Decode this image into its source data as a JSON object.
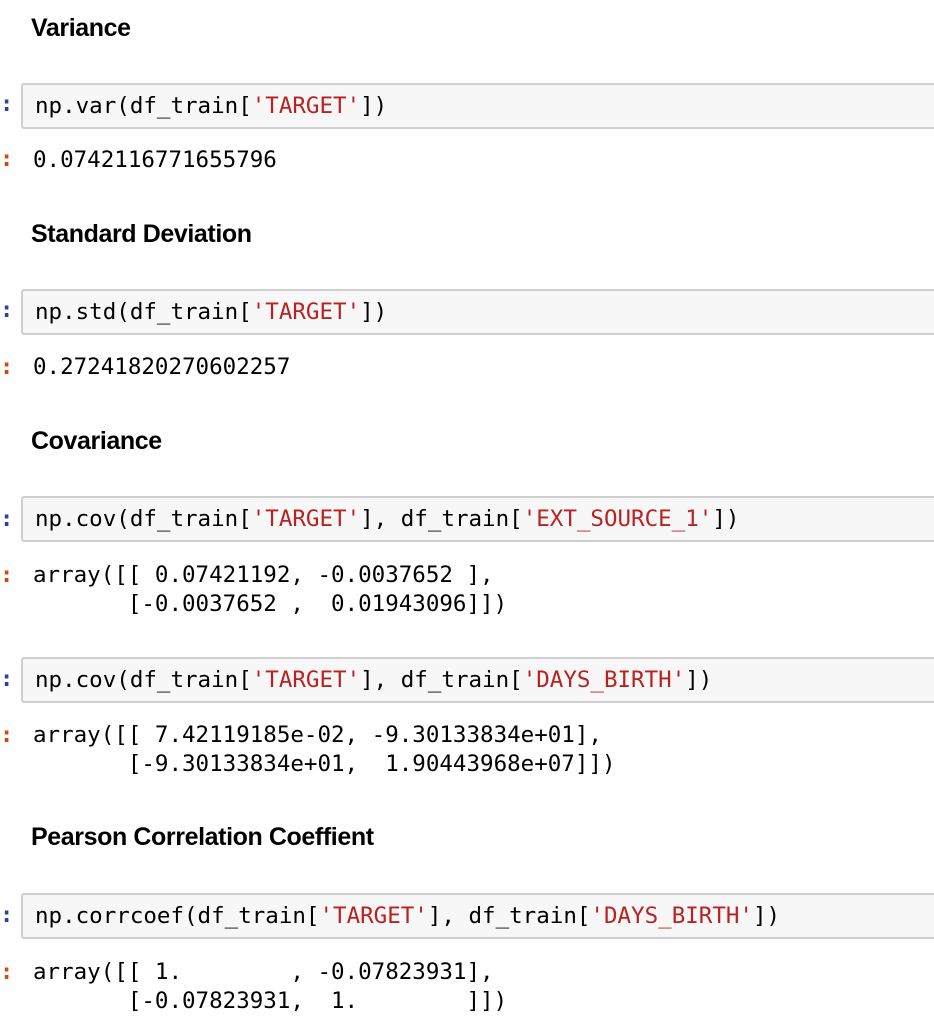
{
  "prompt_symbol": ":",
  "sections": {
    "variance": {
      "heading": "Variance",
      "cell": {
        "code_prefix": "np.var(df_train[",
        "code_str": "'TARGET'",
        "code_suffix": "])",
        "output": [
          "0.0742116771655796"
        ]
      }
    },
    "std": {
      "heading": "Standard Deviation",
      "cell": {
        "code_prefix": "np.std(df_train[",
        "code_str": "'TARGET'",
        "code_suffix": "])",
        "output": [
          "0.27241820270602257"
        ]
      }
    },
    "covariance": {
      "heading": "Covariance",
      "cells": [
        {
          "code_prefix": "np.cov(df_train[",
          "code_str1": "'TARGET'",
          "code_mid": "], df_train[",
          "code_str2": "'EXT_SOURCE_1'",
          "code_suffix": "])",
          "output": [
            "array([[ 0.07421192, -0.0037652 ],",
            "       [-0.0037652 ,  0.01943096]])"
          ]
        },
        {
          "code_prefix": "np.cov(df_train[",
          "code_str1": "'TARGET'",
          "code_mid": "], df_train[",
          "code_str2": "'DAYS_BIRTH'",
          "code_suffix": "])",
          "output": [
            "array([[ 7.42119185e-02, -9.30133834e+01],",
            "       [-9.30133834e+01,  1.90443968e+07]])"
          ]
        }
      ]
    },
    "pearson": {
      "heading": "Pearson Correlation Coeffient",
      "cell": {
        "code_prefix": "np.corrcoef(df_train[",
        "code_str1": "'TARGET'",
        "code_mid": "], df_train[",
        "code_str2": "'DAYS_BIRTH'",
        "code_suffix": "])",
        "output": [
          "array([[ 1.        , -0.07823931],",
          "       [-0.07823931,  1.        ]])"
        ]
      }
    }
  }
}
